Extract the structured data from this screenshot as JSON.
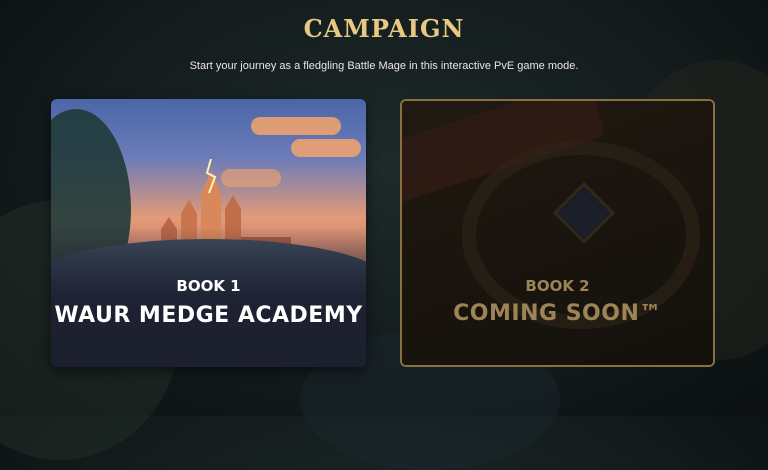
{
  "header": {
    "title": "CAMPAIGN",
    "subtitle": "Start your journey as a fledgling Battle Mage in this interactive PvE game mode."
  },
  "cards": [
    {
      "book": "BOOK 1",
      "title": "WAUR MEDGE ACADEMY",
      "state": "available"
    },
    {
      "book": "BOOK 2",
      "title": "COMING SOON™",
      "state": "locked"
    }
  ],
  "colors": {
    "title_gold": "#e7c984",
    "locked_text": "#9c8456",
    "locked_border": "#8a6f40"
  }
}
